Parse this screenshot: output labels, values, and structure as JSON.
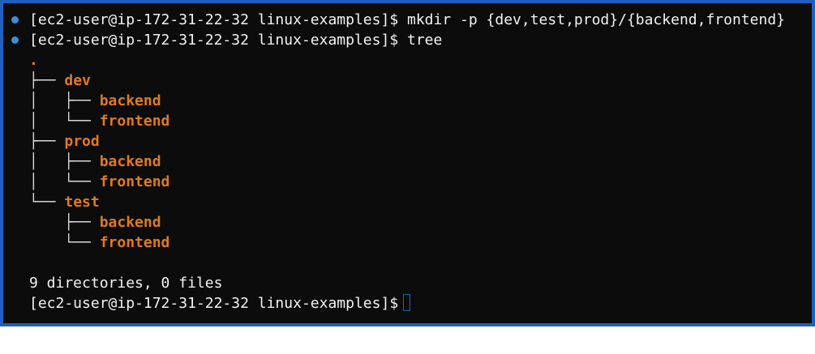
{
  "terminal": {
    "prompt": "[ec2-user@ip-172-31-22-32 linux-examples]$",
    "commands": [
      "mkdir -p {dev,test,prod}/{backend,frontend}",
      "tree"
    ],
    "tree": {
      "root": ".",
      "dirs": [
        {
          "name": "dev",
          "children": [
            "backend",
            "frontend"
          ]
        },
        {
          "name": "prod",
          "children": [
            "backend",
            "frontend"
          ]
        },
        {
          "name": "test",
          "children": [
            "backend",
            "frontend"
          ]
        }
      ]
    },
    "summary": "9 directories, 0 files",
    "colors": {
      "background": "#0c0c0c",
      "text": "#f2f2f2",
      "directory": "#e07a1f",
      "marker": "#3a8fd6",
      "border": "#1f5fbf"
    }
  }
}
